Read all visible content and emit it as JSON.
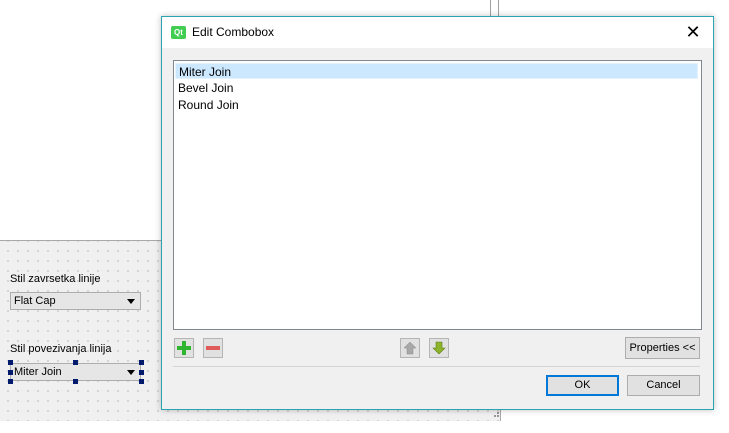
{
  "designer": {
    "label_end_style": "Stil zavrsetka linije",
    "combo_end_style": "Flat Cap",
    "label_join_style": "Stil povezivanja linija",
    "combo_join_style": "Miter Join"
  },
  "dialog": {
    "title": "Edit Combobox",
    "logo_text": "Qt",
    "close_glyph": "✕",
    "items": [
      "Miter Join",
      "Bevel Join",
      "Round Join"
    ],
    "selected_index": 0,
    "properties_label": "Properties <<",
    "ok_label": "OK",
    "cancel_label": "Cancel"
  },
  "colors": {
    "accent_border": "#2aa4b0",
    "selection": "#cce8ff",
    "add_icon": "#2fb52f",
    "remove_icon": "#e05a5a",
    "move_down_icon": "#8db32a",
    "ok_focus": "#0078d7"
  }
}
